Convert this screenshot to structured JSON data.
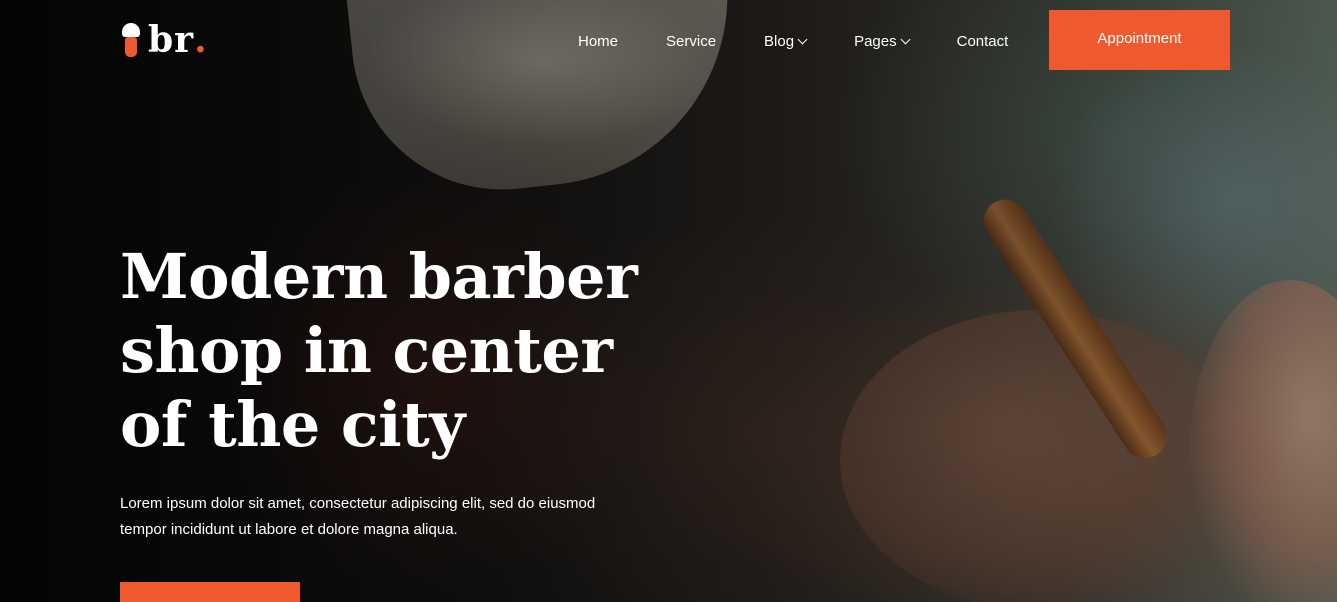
{
  "brand": {
    "name": "br",
    "dot": ".",
    "accent_color": "#ee5a2e",
    "icon": "shaving-brush-icon"
  },
  "nav": {
    "items": [
      {
        "label": "Home"
      },
      {
        "label": "Service"
      },
      {
        "label": "Blog",
        "icon": "chevron-down-icon"
      },
      {
        "label": "Pages",
        "icon": "chevron-down-icon"
      },
      {
        "label": "Contact"
      }
    ],
    "appointment_label": "Appointment"
  },
  "hero": {
    "headline_line1": "Modern barber",
    "headline_line2": "shop in center",
    "headline_line3": "of the city",
    "description": "Lorem ipsum dolor sit amet, consectetur adipiscing elit, sed do eiusmod tempor incididunt ut labore et dolore magna aliqua.",
    "cta_label": ""
  }
}
